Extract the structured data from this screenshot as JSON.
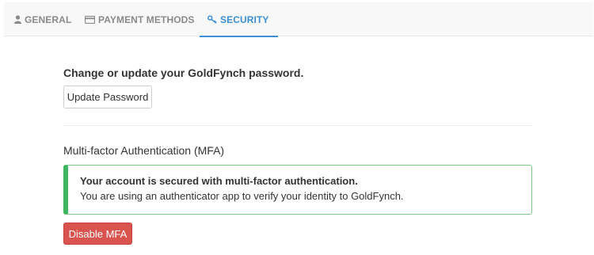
{
  "tabs": [
    {
      "label": "GENERAL",
      "icon": "user-icon",
      "active": false
    },
    {
      "label": "PAYMENT METHODS",
      "icon": "credit-card-icon",
      "active": false
    },
    {
      "label": "SECURITY",
      "icon": "key-icon",
      "active": true
    }
  ],
  "password": {
    "heading": "Change or update your GoldFynch password.",
    "button_label": "Update Password"
  },
  "mfa": {
    "heading": "Multi-factor Authentication (MFA)",
    "alert_title": "Your account is secured with multi-factor authentication.",
    "alert_body": "You are using an authenticator app to verify your identity to GoldFynch.",
    "disable_button_label": "Disable MFA"
  },
  "colors": {
    "accent": "#3a8fd6",
    "success_border": "#3fb560",
    "danger": "#d9534f",
    "tab_inactive": "#8a8a8a"
  }
}
